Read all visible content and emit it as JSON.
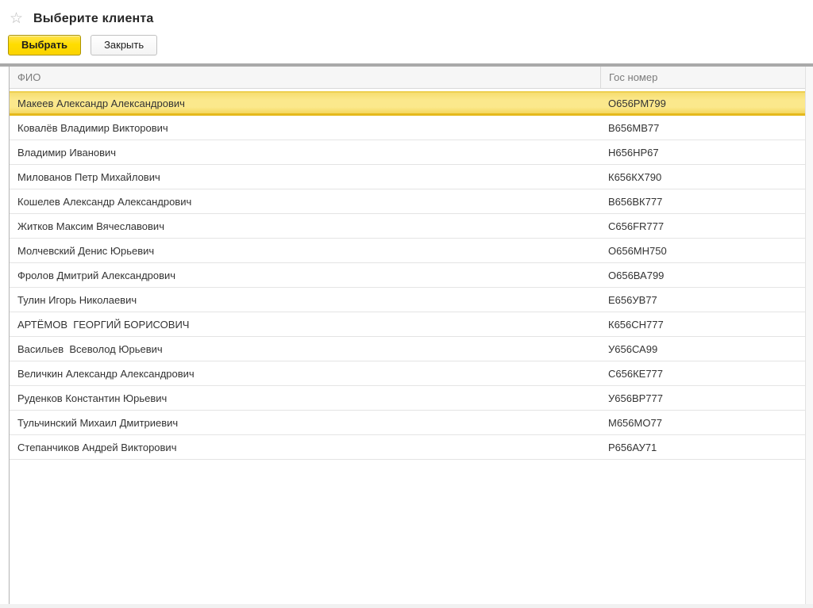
{
  "window": {
    "title": "Выберите клиента"
  },
  "icons": {
    "favorite_star": "☆"
  },
  "toolbar": {
    "select_label": "Выбрать",
    "close_label": "Закрыть"
  },
  "table": {
    "columns": [
      {
        "key": "fio",
        "label": "ФИО"
      },
      {
        "key": "gos",
        "label": "Гос номер"
      }
    ],
    "selected_index": 0,
    "rows": [
      {
        "fio": "Макеев Александр Александрович",
        "gos": "О656РМ799"
      },
      {
        "fio": "Ковалёв Владимир Викторович",
        "gos": "В656МВ77"
      },
      {
        "fio": "Владимир Иванович",
        "gos": "Н656НР67"
      },
      {
        "fio": "Милованов Петр Михайлович",
        "gos": "К656КХ790"
      },
      {
        "fio": "Кошелев Александр Александрович",
        "gos": "В656ВК777"
      },
      {
        "fio": "Житков Максим Вячеславович",
        "gos": "С656FR777"
      },
      {
        "fio": "Молчевский Денис Юрьевич",
        "gos": "О656МН750"
      },
      {
        "fio": "Фролов Дмитрий Александрович",
        "gos": "О656ВА799"
      },
      {
        "fio": "Тулин Игорь Николаевич",
        "gos": "Е656УВ77"
      },
      {
        "fio": "АРТЁМОВ  ГЕОРГИЙ БОРИСОВИЧ",
        "gos": "К656СН777"
      },
      {
        "fio": "Васильев  Всеволод Юрьевич",
        "gos": "У656СА99"
      },
      {
        "fio": "Величкин Александр Александрович",
        "gos": "С656КЕ777"
      },
      {
        "fio": "Руденков Константин Юрьевич",
        "gos": "У656ВР777"
      },
      {
        "fio": "Тульчинский Михаил Дмитриевич",
        "gos": "М656МО77"
      },
      {
        "fio": "Степанчиков Андрей Викторович",
        "gos": "Р656АУ71"
      }
    ]
  },
  "colors": {
    "accent_yellow": "#FFDD00",
    "selection_bg": "#FBE88C",
    "selection_border_bottom": "#E5B91C",
    "table_top_bar": "#A9A9A9",
    "header_bg": "#F6F6F6",
    "header_text": "#7B7B7B",
    "row_text": "#333333"
  }
}
